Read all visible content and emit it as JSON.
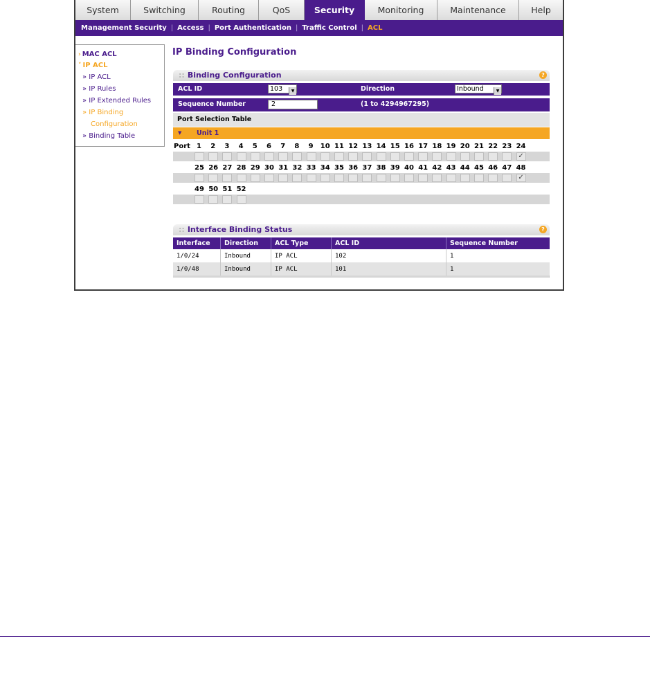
{
  "top_tabs": [
    {
      "label": "System"
    },
    {
      "label": "Switching"
    },
    {
      "label": "Routing"
    },
    {
      "label": "QoS"
    },
    {
      "label": "Security"
    },
    {
      "label": "Monitoring"
    },
    {
      "label": "Maintenance"
    },
    {
      "label": "Help"
    }
  ],
  "sub_nav": [
    {
      "label": "Management Security"
    },
    {
      "label": "Access"
    },
    {
      "label": "Port Authentication"
    },
    {
      "label": "Traffic Control"
    },
    {
      "label": "ACL"
    }
  ],
  "sidebar": {
    "mac_acl": "MAC ACL",
    "ip_acl": "IP ACL",
    "items": [
      {
        "label": "» IP ACL"
      },
      {
        "label": "» IP Rules"
      },
      {
        "label": "» IP Extended Rules"
      },
      {
        "label": "» IP Binding"
      },
      {
        "label": "Configuration"
      },
      {
        "label": "» Binding Table"
      }
    ]
  },
  "page_title": "IP Binding Configuration",
  "binding_config": {
    "heading": "Binding Configuration",
    "acl_id_label": "ACL ID",
    "acl_id_value": "103",
    "direction_label": "Direction",
    "direction_value": "Inbound",
    "sequence_label": "Sequence Number",
    "sequence_value": "2",
    "sequence_range": "(1 to 4294967295)",
    "port_selection_label": "Port Selection Table",
    "unit_label": "Unit 1",
    "port_label": "Port",
    "port_rows": [
      [
        "1",
        "2",
        "3",
        "4",
        "5",
        "6",
        "7",
        "8",
        "9",
        "10",
        "11",
        "12",
        "13",
        "14",
        "15",
        "16",
        "17",
        "18",
        "19",
        "20",
        "21",
        "22",
        "23",
        "24"
      ],
      [
        "25",
        "26",
        "27",
        "28",
        "29",
        "30",
        "31",
        "32",
        "33",
        "34",
        "35",
        "36",
        "37",
        "38",
        "39",
        "40",
        "41",
        "42",
        "43",
        "44",
        "45",
        "46",
        "47",
        "48"
      ],
      [
        "49",
        "50",
        "51",
        "52"
      ]
    ],
    "checked_ports": [
      "24",
      "48"
    ],
    "check_mark": "✓"
  },
  "status": {
    "heading": "Interface Binding Status",
    "columns": [
      "Interface",
      "Direction",
      "ACL Type",
      "ACL ID",
      "Sequence Number"
    ],
    "rows": [
      [
        "1/0/24",
        "Inbound",
        "IP ACL",
        "102",
        "1"
      ],
      [
        "1/0/48",
        "Inbound",
        "IP ACL",
        "101",
        "1"
      ]
    ]
  },
  "colors": {
    "brand_purple": "#4a1c8c",
    "accent_orange": "#f5a623"
  }
}
